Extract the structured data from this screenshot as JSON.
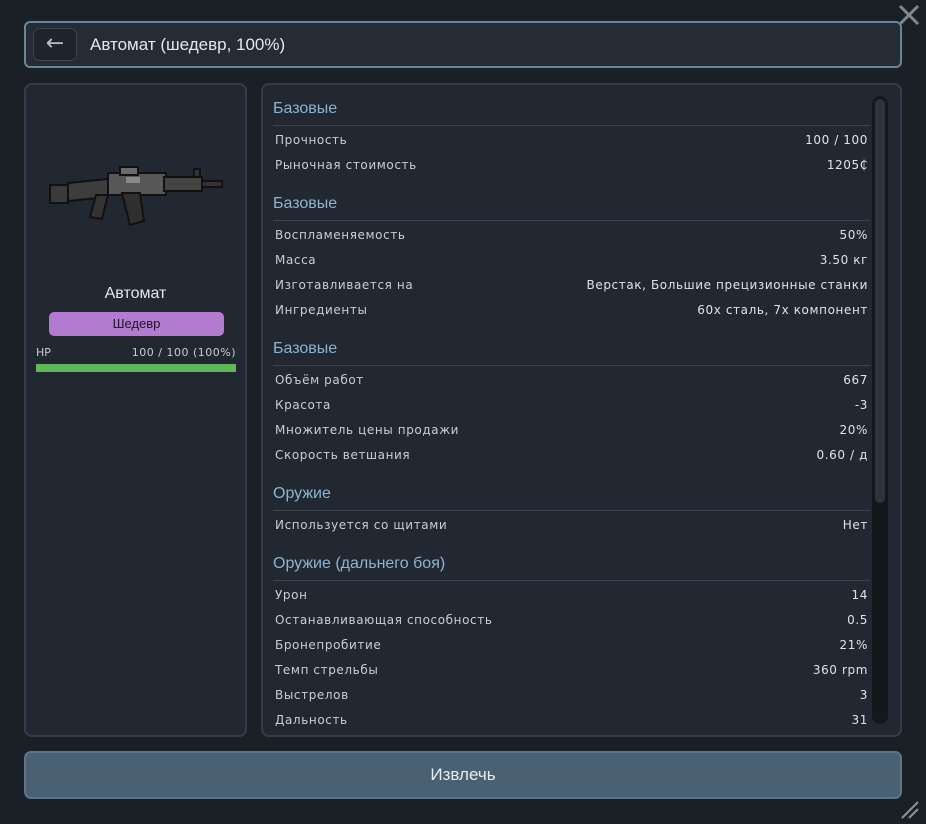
{
  "header": {
    "back_icon": "←",
    "title": "Автомат (шедевр, 100%)"
  },
  "item": {
    "name": "Автомат",
    "quality": "Шедевр",
    "quality_color": "#b27bd0",
    "hp_label": "HP",
    "hp_value": "100 / 100 (100%)",
    "hp_fraction": 1.0,
    "hp_color": "#5fb85b"
  },
  "sections": [
    {
      "title": "Базовые",
      "rows": [
        {
          "label": "Прочность",
          "value": "100 / 100"
        },
        {
          "label": "Рыночная стоимость",
          "value": "1205₵"
        }
      ]
    },
    {
      "title": "Базовые",
      "rows": [
        {
          "label": "Воспламеняемость",
          "value": "50%"
        },
        {
          "label": "Масса",
          "value": "3.50 кг"
        },
        {
          "label": "Изготавливается на",
          "value": "Верстак, Большие прецизионные станки"
        },
        {
          "label": "Ингредиенты",
          "value": "60x сталь, 7x компонент"
        }
      ]
    },
    {
      "title": "Базовые",
      "rows": [
        {
          "label": "Объём работ",
          "value": "667"
        },
        {
          "label": "Красота",
          "value": "-3"
        },
        {
          "label": "Множитель цены продажи",
          "value": "20%"
        },
        {
          "label": "Скорость ветшания",
          "value": "0.60 / д"
        }
      ]
    },
    {
      "title": "Оружие",
      "rows": [
        {
          "label": "Используется со щитами",
          "value": "Нет"
        }
      ]
    },
    {
      "title": "Оружие (дальнего боя)",
      "rows": [
        {
          "label": "Урон",
          "value": "14"
        },
        {
          "label": "Останавливающая способность",
          "value": "0.5"
        },
        {
          "label": "Бронепробитие",
          "value": "21%"
        },
        {
          "label": "Темп стрельбы",
          "value": "360 rpm"
        },
        {
          "label": "Выстрелов",
          "value": "3"
        },
        {
          "label": "Дальность",
          "value": "31"
        }
      ]
    }
  ],
  "actions": {
    "extract_label": "Извлечь"
  },
  "icons": {
    "close": "close-icon",
    "item": "assault-rifle-icon",
    "resize": "resize-grip-icon"
  }
}
